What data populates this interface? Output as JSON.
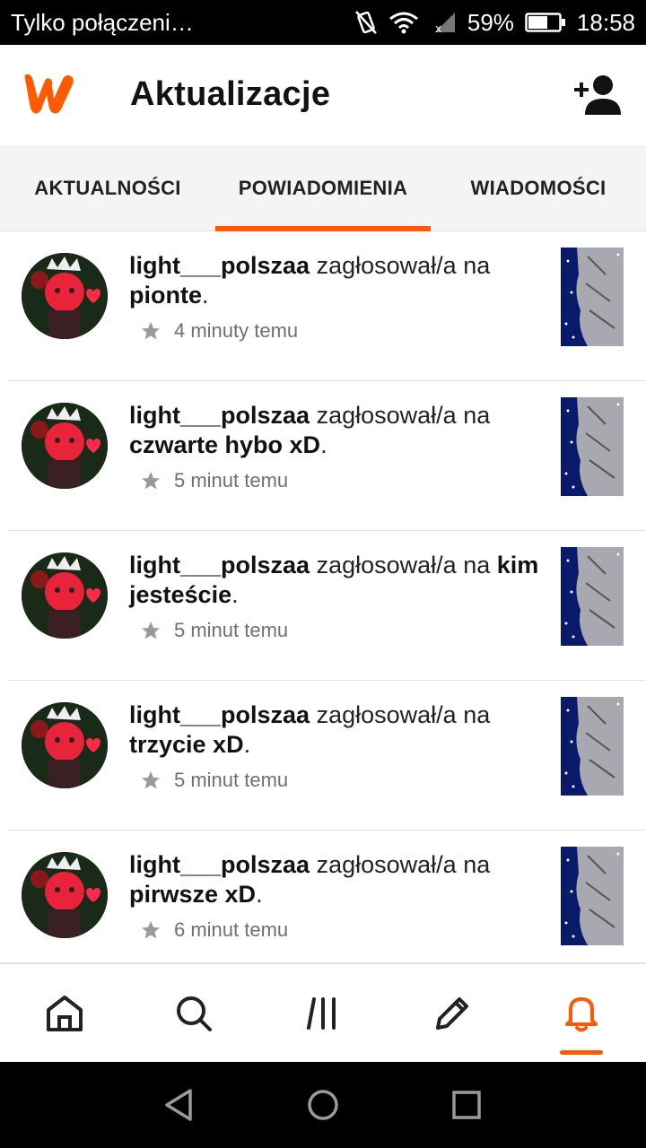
{
  "status_bar": {
    "carrier": "Tylko połączeni…",
    "battery": "59%",
    "time": "18:58"
  },
  "header": {
    "title": "Aktualizacje",
    "logo_icon": "wattpad-logo",
    "add_friend_icon": "add-person-icon"
  },
  "tabs": [
    {
      "label": "AKTUALNOŚCI",
      "active": false
    },
    {
      "label": "POWIADOMIENIA",
      "active": true
    },
    {
      "label": "WIADOMOŚCI",
      "active": false
    }
  ],
  "notifications": [
    {
      "user": "light___polszaa",
      "action": "zagłosował/a na",
      "story": "pionte",
      "time": "4 minuty temu"
    },
    {
      "user": "light___polszaa",
      "action": "zagłosował/a na",
      "story": "czwarte hybo xD",
      "time": "5 minut temu"
    },
    {
      "user": "light___polszaa",
      "action": "zagłosował/a na",
      "story": "kim jesteście",
      "time": "5 minut temu"
    },
    {
      "user": "light___polszaa",
      "action": "zagłosował/a na",
      "story": "trzycie xD",
      "time": "5 minut temu"
    },
    {
      "user": "light___polszaa",
      "action": "zagłosował/a na",
      "story": "pirwsze xD",
      "time": "6 minut temu"
    }
  ],
  "bottom_nav": [
    {
      "icon": "home-icon",
      "active": false
    },
    {
      "icon": "search-icon",
      "active": false
    },
    {
      "icon": "library-icon",
      "active": false
    },
    {
      "icon": "write-icon",
      "active": false
    },
    {
      "icon": "bell-icon",
      "active": true
    }
  ],
  "colors": {
    "accent": "#ff5a00",
    "cover_bg": "#0a1a6b"
  }
}
